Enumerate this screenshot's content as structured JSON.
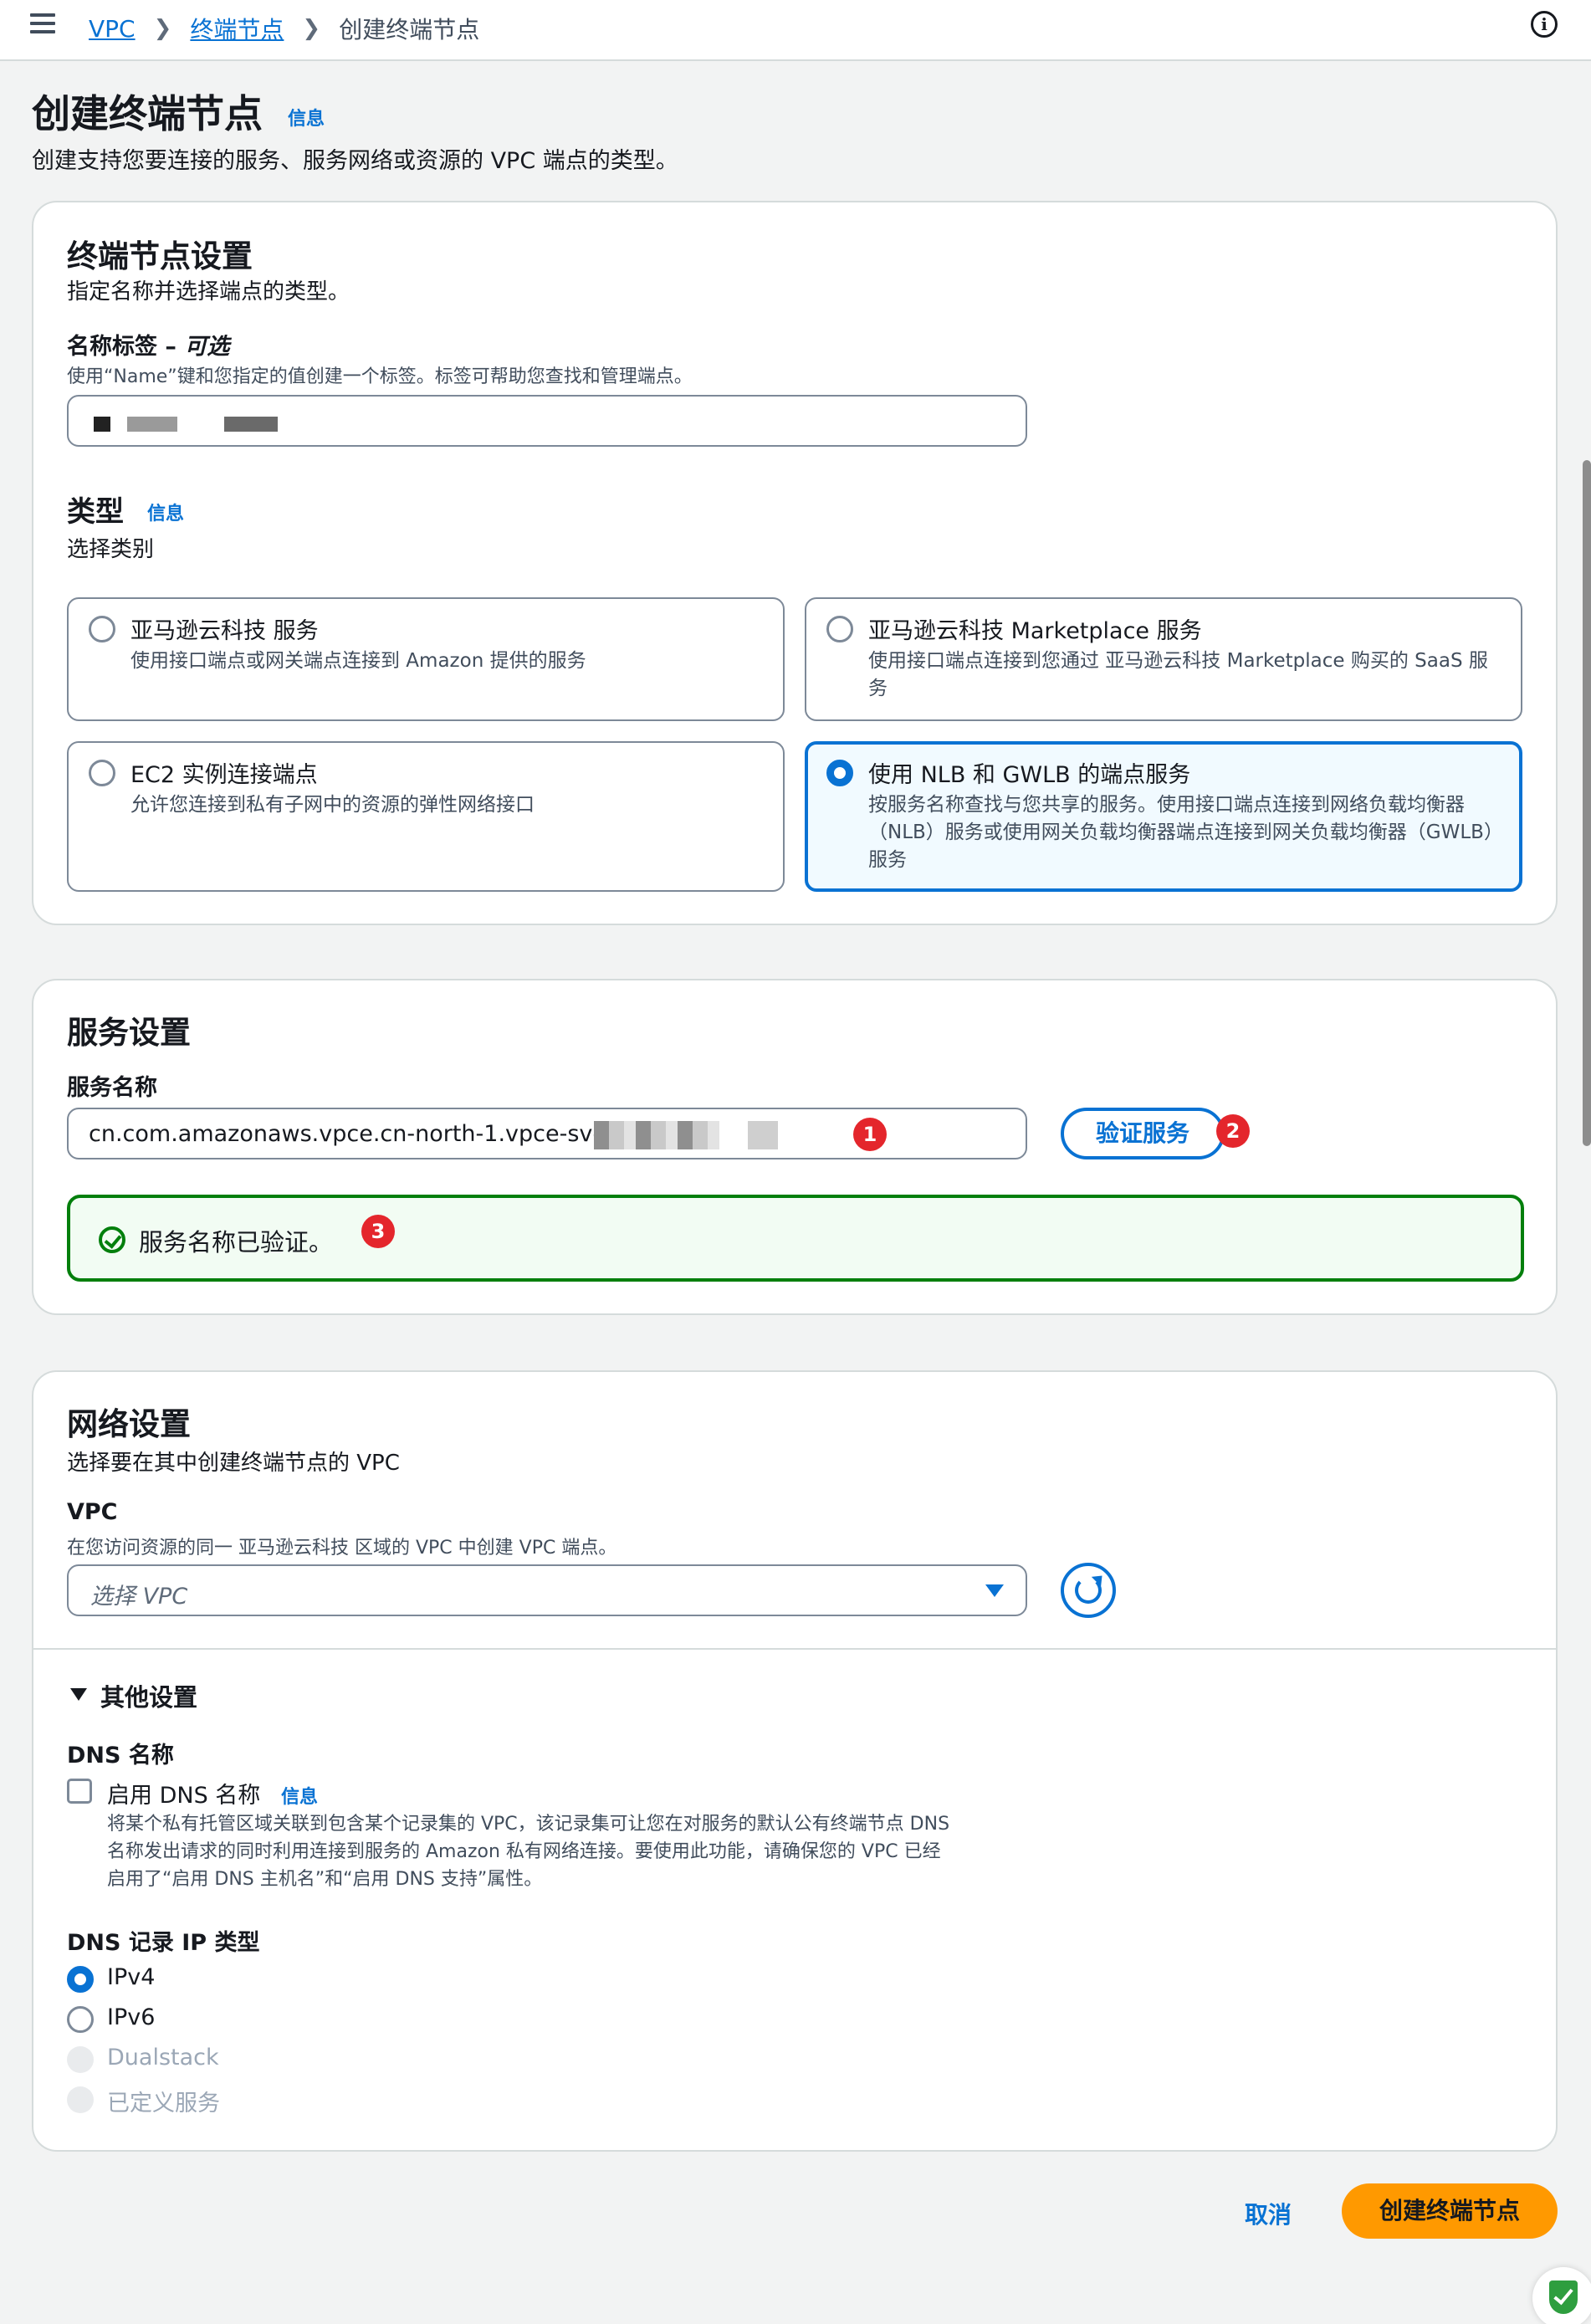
{
  "breadcrumb": {
    "vpc": "VPC",
    "endpoints": "终端节点",
    "current": "创建终端节点"
  },
  "header": {
    "title": "创建终端节点",
    "info": "信息",
    "description": "创建支持您要连接的服务、服务网络或资源的 VPC 端点的类型。"
  },
  "endpoint_settings": {
    "title": "终端节点设置",
    "description": "指定名称并选择端点的类型。",
    "name_label": "名称标签 – ",
    "name_optional": "可选",
    "name_hint": "使用“Name”键和您指定的值创建一个标签。标签可帮助您查找和管理端点。",
    "type_title": "类型",
    "type_info": "信息",
    "type_desc": "选择类别",
    "types": [
      {
        "title": "亚马逊云科技 服务",
        "desc": "使用接口端点或网关端点连接到 Amazon 提供的服务",
        "selected": false
      },
      {
        "title": "亚马逊云科技 Marketplace 服务",
        "desc": "使用接口端点连接到您通过 亚马逊云科技 Marketplace 购买的 SaaS 服务",
        "selected": false
      },
      {
        "title": "EC2 实例连接端点",
        "desc": "允许您连接到私有子网中的资源的弹性网络接口",
        "selected": false
      },
      {
        "title": "使用 NLB 和 GWLB 的端点服务",
        "desc": "按服务名称查找与您共享的服务。使用接口端点连接到网络负载均衡器（NLB）服务或使用网关负载均衡器端点连接到网关负载均衡器（GWLB）服务",
        "selected": true
      }
    ]
  },
  "service_settings": {
    "title": "服务设置",
    "name_label": "服务名称",
    "service_name": "cn.com.amazonaws.vpce.cn-north-1.vpce-svc-",
    "verify_button": "验证服务",
    "verified_message": "服务名称已验证。",
    "badges": [
      "1",
      "2",
      "3"
    ]
  },
  "network_settings": {
    "title": "网络设置",
    "description": "选择要在其中创建终端节点的 VPC",
    "vpc_label": "VPC",
    "vpc_hint": "在您访问资源的同一 亚马逊云科技 区域的 VPC 中创建 VPC 端点。",
    "vpc_placeholder": "选择 VPC",
    "other_settings": "其他设置",
    "dns_name_title": "DNS 名称",
    "dns_enable_label": "启用 DNS 名称",
    "dns_info": "信息",
    "dns_desc_1": "将某个私有托管区域关联到包含某个记录集的 VPC，该记录集可让您在对服务的默认公有终端节点 DNS",
    "dns_desc_2": "名称发出请求的同时利用连接到服务的 Amazon 私有网络连接。要使用此功能，请确保您的 VPC 已经",
    "dns_desc_3": "启用了“启用 DNS 主机名”和“启用 DNS 支持”属性。",
    "ip_type_title": "DNS 记录 IP 类型",
    "ip_types": [
      {
        "label": "IPv4",
        "selected": true,
        "disabled": false
      },
      {
        "label": "IPv6",
        "selected": false,
        "disabled": false
      },
      {
        "label": "Dualstack",
        "selected": false,
        "disabled": true
      },
      {
        "label": "已定义服务",
        "selected": false,
        "disabled": true
      }
    ]
  },
  "footer": {
    "cancel": "取消",
    "create": "创建终端节点"
  },
  "colors": {
    "accent": "#0972d3",
    "primary_button": "#ff9900",
    "success": "#037f0c",
    "badge": "#e4262c"
  }
}
